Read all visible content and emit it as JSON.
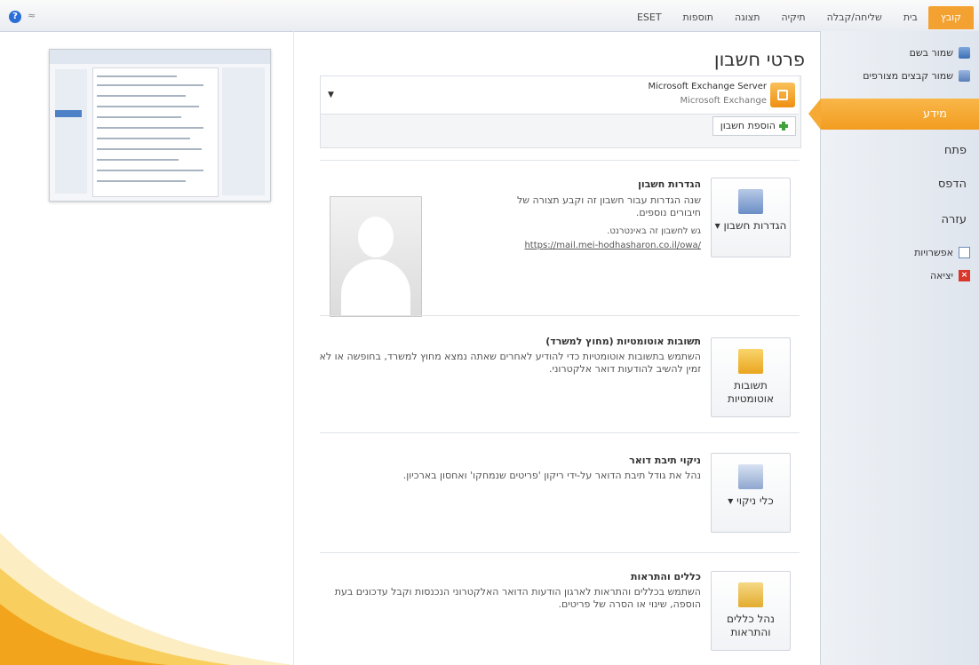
{
  "topbar": {
    "tabs": [
      "קובץ",
      "בית",
      "שליחה/קבלה",
      "תיקיה",
      "תצוגה",
      "תוספות",
      "ESET"
    ],
    "help_icon": "?",
    "minimize_glyph": "≈"
  },
  "nav": {
    "commands": [
      {
        "icon": "save-icon",
        "label": "שמור בשם"
      },
      {
        "icon": "save-attachments-icon",
        "label": "שמור קבצים מצורפים"
      }
    ],
    "selected": "מידע",
    "items": [
      "פתח",
      "הדפס",
      "עזרה"
    ],
    "bottom_commands": [
      {
        "icon": "options-icon",
        "label": "אפשרויות"
      },
      {
        "icon": "exit-icon",
        "label": "יציאה"
      }
    ]
  },
  "main": {
    "title": "פרטי חשבון",
    "account": {
      "name": "Microsoft Exchange Server",
      "type": "Microsoft Exchange",
      "dropdown_arrow": "▼"
    },
    "add_account": "הוספת חשבון",
    "sections": [
      {
        "button": "הגדרות חשבון ▾",
        "title": "הגדרות חשבון",
        "desc": "שנה הגדרות עבור חשבון זה וקבע תצורה של חיבורים נוספים.",
        "bullet": "גש לחשבון זה באינטרנט.",
        "link": "https://mail.mei-hodhasharon.co.il/owa/"
      },
      {
        "button": "תשובות אוטומטיות",
        "title": "תשובות אוטומטיות (מחוץ למשרד)",
        "desc": "השתמש בתשובות אוטומטיות כדי להודיע לאחרים שאתה נמצא מחוץ למשרד, בחופשה או לא זמין להשיב להודעות דואר אלקטרוני."
      },
      {
        "button": "כלי ניקוי ▾",
        "title": "ניקוי תיבת דואר",
        "desc": "נהל את גודל תיבת הדואר על-ידי ריקון 'פריטים שנמחקו' ואחסון בארכיון."
      },
      {
        "button": "נהל כללים והתראות",
        "title": "כללים והתראות",
        "desc": "השתמש בכללים והתראות לארגון הודעות הדואר האלקטרוני הנכנסות וקבל עדכונים בעת הוספה, שינוי או הסרה של פריטים."
      }
    ]
  },
  "colors": {
    "accent": "#f3a130",
    "nav_bg": "#e6ebf2",
    "link": "#555555"
  }
}
